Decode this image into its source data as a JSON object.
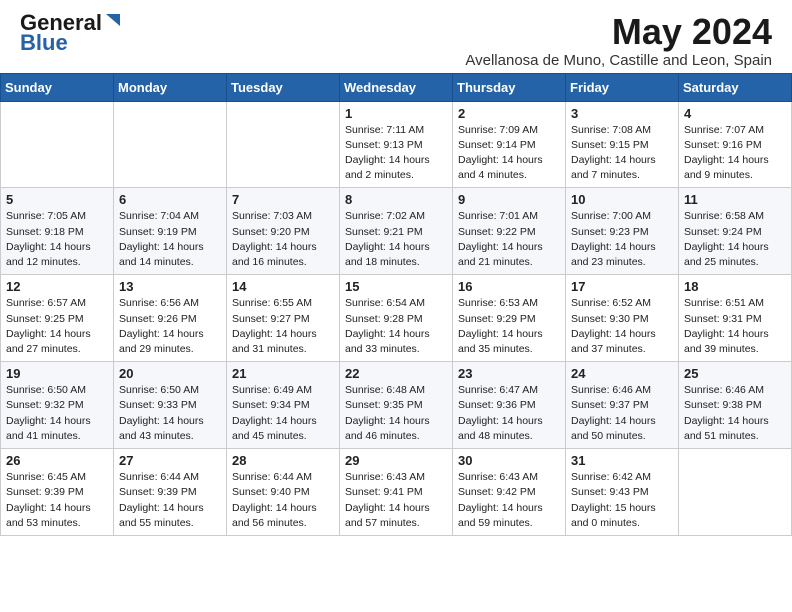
{
  "header": {
    "logo_line1": "General",
    "logo_line2": "Blue",
    "month_title": "May 2024",
    "location": "Avellanosa de Muno, Castille and Leon, Spain"
  },
  "weekdays": [
    "Sunday",
    "Monday",
    "Tuesday",
    "Wednesday",
    "Thursday",
    "Friday",
    "Saturday"
  ],
  "weeks": [
    [
      {
        "day": "",
        "info": ""
      },
      {
        "day": "",
        "info": ""
      },
      {
        "day": "",
        "info": ""
      },
      {
        "day": "1",
        "info": "Sunrise: 7:11 AM\nSunset: 9:13 PM\nDaylight: 14 hours\nand 2 minutes."
      },
      {
        "day": "2",
        "info": "Sunrise: 7:09 AM\nSunset: 9:14 PM\nDaylight: 14 hours\nand 4 minutes."
      },
      {
        "day": "3",
        "info": "Sunrise: 7:08 AM\nSunset: 9:15 PM\nDaylight: 14 hours\nand 7 minutes."
      },
      {
        "day": "4",
        "info": "Sunrise: 7:07 AM\nSunset: 9:16 PM\nDaylight: 14 hours\nand 9 minutes."
      }
    ],
    [
      {
        "day": "5",
        "info": "Sunrise: 7:05 AM\nSunset: 9:18 PM\nDaylight: 14 hours\nand 12 minutes."
      },
      {
        "day": "6",
        "info": "Sunrise: 7:04 AM\nSunset: 9:19 PM\nDaylight: 14 hours\nand 14 minutes."
      },
      {
        "day": "7",
        "info": "Sunrise: 7:03 AM\nSunset: 9:20 PM\nDaylight: 14 hours\nand 16 minutes."
      },
      {
        "day": "8",
        "info": "Sunrise: 7:02 AM\nSunset: 9:21 PM\nDaylight: 14 hours\nand 18 minutes."
      },
      {
        "day": "9",
        "info": "Sunrise: 7:01 AM\nSunset: 9:22 PM\nDaylight: 14 hours\nand 21 minutes."
      },
      {
        "day": "10",
        "info": "Sunrise: 7:00 AM\nSunset: 9:23 PM\nDaylight: 14 hours\nand 23 minutes."
      },
      {
        "day": "11",
        "info": "Sunrise: 6:58 AM\nSunset: 9:24 PM\nDaylight: 14 hours\nand 25 minutes."
      }
    ],
    [
      {
        "day": "12",
        "info": "Sunrise: 6:57 AM\nSunset: 9:25 PM\nDaylight: 14 hours\nand 27 minutes."
      },
      {
        "day": "13",
        "info": "Sunrise: 6:56 AM\nSunset: 9:26 PM\nDaylight: 14 hours\nand 29 minutes."
      },
      {
        "day": "14",
        "info": "Sunrise: 6:55 AM\nSunset: 9:27 PM\nDaylight: 14 hours\nand 31 minutes."
      },
      {
        "day": "15",
        "info": "Sunrise: 6:54 AM\nSunset: 9:28 PM\nDaylight: 14 hours\nand 33 minutes."
      },
      {
        "day": "16",
        "info": "Sunrise: 6:53 AM\nSunset: 9:29 PM\nDaylight: 14 hours\nand 35 minutes."
      },
      {
        "day": "17",
        "info": "Sunrise: 6:52 AM\nSunset: 9:30 PM\nDaylight: 14 hours\nand 37 minutes."
      },
      {
        "day": "18",
        "info": "Sunrise: 6:51 AM\nSunset: 9:31 PM\nDaylight: 14 hours\nand 39 minutes."
      }
    ],
    [
      {
        "day": "19",
        "info": "Sunrise: 6:50 AM\nSunset: 9:32 PM\nDaylight: 14 hours\nand 41 minutes."
      },
      {
        "day": "20",
        "info": "Sunrise: 6:50 AM\nSunset: 9:33 PM\nDaylight: 14 hours\nand 43 minutes."
      },
      {
        "day": "21",
        "info": "Sunrise: 6:49 AM\nSunset: 9:34 PM\nDaylight: 14 hours\nand 45 minutes."
      },
      {
        "day": "22",
        "info": "Sunrise: 6:48 AM\nSunset: 9:35 PM\nDaylight: 14 hours\nand 46 minutes."
      },
      {
        "day": "23",
        "info": "Sunrise: 6:47 AM\nSunset: 9:36 PM\nDaylight: 14 hours\nand 48 minutes."
      },
      {
        "day": "24",
        "info": "Sunrise: 6:46 AM\nSunset: 9:37 PM\nDaylight: 14 hours\nand 50 minutes."
      },
      {
        "day": "25",
        "info": "Sunrise: 6:46 AM\nSunset: 9:38 PM\nDaylight: 14 hours\nand 51 minutes."
      }
    ],
    [
      {
        "day": "26",
        "info": "Sunrise: 6:45 AM\nSunset: 9:39 PM\nDaylight: 14 hours\nand 53 minutes."
      },
      {
        "day": "27",
        "info": "Sunrise: 6:44 AM\nSunset: 9:39 PM\nDaylight: 14 hours\nand 55 minutes."
      },
      {
        "day": "28",
        "info": "Sunrise: 6:44 AM\nSunset: 9:40 PM\nDaylight: 14 hours\nand 56 minutes."
      },
      {
        "day": "29",
        "info": "Sunrise: 6:43 AM\nSunset: 9:41 PM\nDaylight: 14 hours\nand 57 minutes."
      },
      {
        "day": "30",
        "info": "Sunrise: 6:43 AM\nSunset: 9:42 PM\nDaylight: 14 hours\nand 59 minutes."
      },
      {
        "day": "31",
        "info": "Sunrise: 6:42 AM\nSunset: 9:43 PM\nDaylight: 15 hours\nand 0 minutes."
      },
      {
        "day": "",
        "info": ""
      }
    ]
  ]
}
